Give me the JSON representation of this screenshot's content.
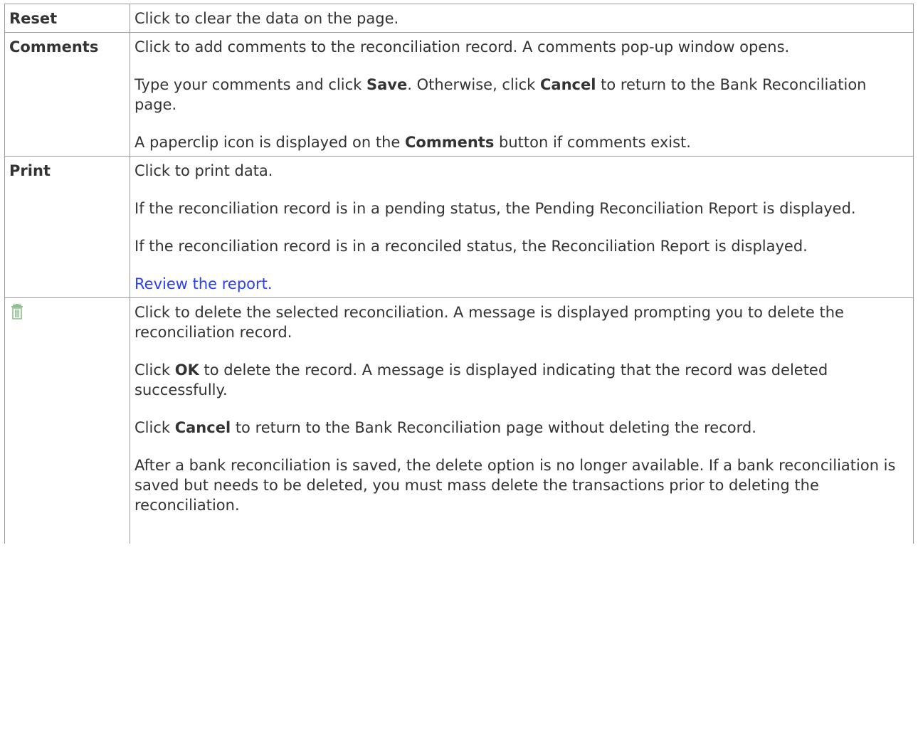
{
  "rows": [
    {
      "label": "Reset",
      "p1": "Click to clear the data on the page."
    },
    {
      "label": "Comments",
      "p1": "Click to add comments to the reconciliation record. A comments pop-up window opens.",
      "p2_pre": "Type your comments and click ",
      "p2_save": "Save",
      "p2_mid": ". Otherwise, click ",
      "p2_cancel": "Cancel",
      "p2_post": " to return to the Bank Reconciliation page.",
      "p3_pre": "A paperclip icon is displayed on the ",
      "p3_bold": "Comments",
      "p3_post": " button if comments exist."
    },
    {
      "label": "Print",
      "p1": "Click to print data.",
      "p2": "If the reconciliation record is in a pending status, the Pending Reconciliation Report is displayed.",
      "p3": "If the reconciliation record is in a reconciled status, the Reconciliation Report is displayed.",
      "link": "Review the report."
    },
    {
      "icon": "trash-icon",
      "icon_color": "#8fbf8f",
      "p1": "Click to delete the selected reconciliation. A message is displayed prompting you to delete the reconciliation record.",
      "p2_pre": "Click ",
      "p2_ok": "OK",
      "p2_post": " to delete the record. A message is displayed indicating that the record was deleted successfully.",
      "p3_pre": "Click ",
      "p3_cancel": "Cancel",
      "p3_post": " to return to the Bank Reconciliation page without deleting the record.",
      "p4": "After a bank reconciliation is saved, the delete option is no longer available. If a bank reconciliation is saved but needs to be deleted, you must mass delete the transactions prior to deleting the reconciliation."
    }
  ]
}
